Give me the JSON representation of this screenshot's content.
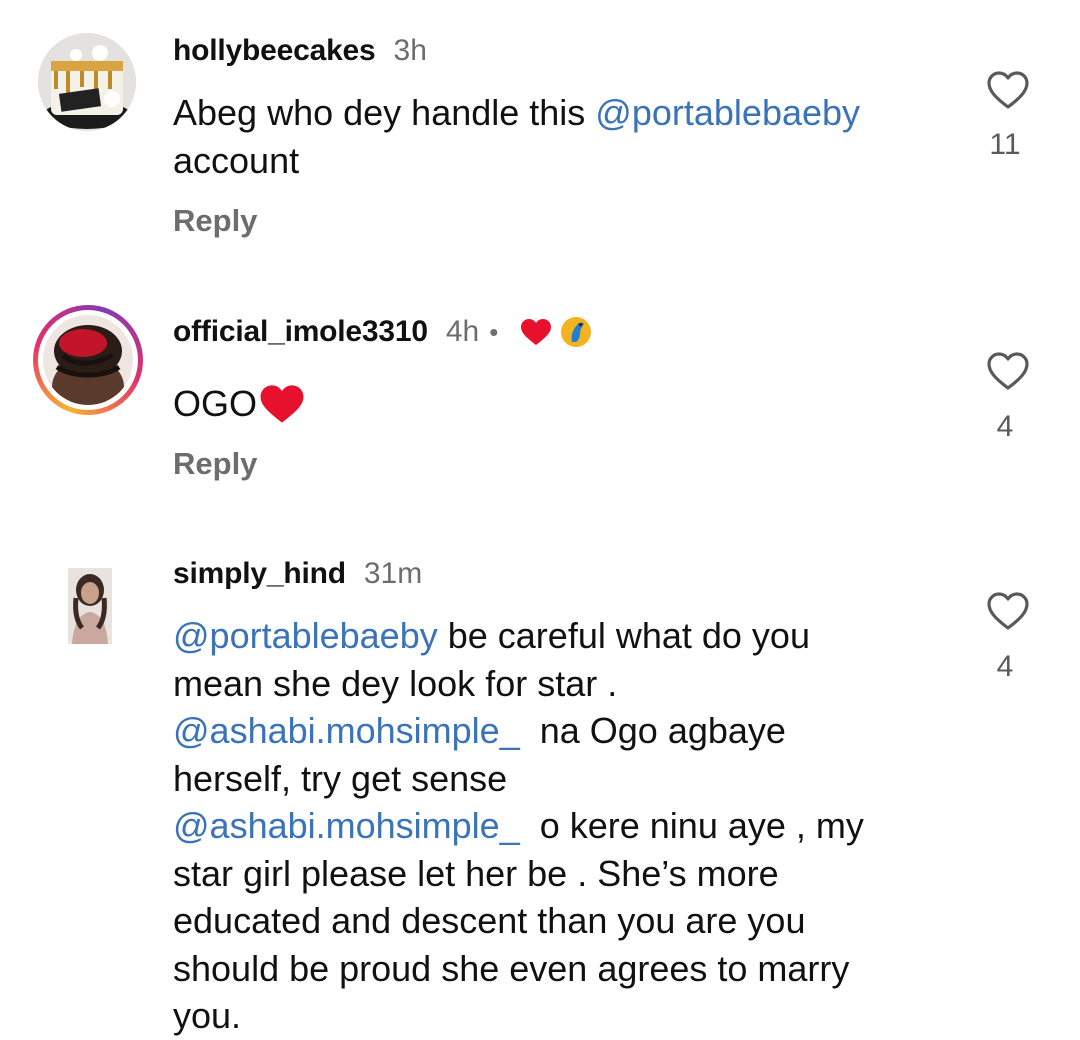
{
  "comments": [
    {
      "username": "hollybeecakes",
      "time": "3h",
      "text_mention": "@portablebaeby",
      "text_line1": "Abeg who dey handle this ",
      "text_line2": "account",
      "reply_label": "Reply",
      "likes": "11",
      "avatar_icon": "birthday-cake-photo"
    },
    {
      "username": "official_imole3310",
      "time": "4h",
      "dot": "•",
      "badges": [
        "heart-emoji",
        "parrot-emoji"
      ],
      "text": "OGO",
      "text_emoji": "red-heart-emoji",
      "reply_label": "Reply",
      "likes": "4",
      "avatar_icon": "hair-photo",
      "story_ring_colors": [
        "#f9b234",
        "#e1306c",
        "#833ab4"
      ]
    },
    {
      "username": "simply_hind",
      "time": "31m",
      "likes": "4",
      "avatar_icon": "profile-photo",
      "mention1": "@portablebaeby",
      "line1": " be careful what do you",
      "line2": "mean she dey look for star .",
      "mention2": "@ashabi.mohsimple_",
      "line3": "  na Ogo agbaye",
      "line4": "herself, try get sense",
      "mention3": "@ashabi.mohsimple_",
      "line5": "  o kere ninu aye , my",
      "line6": "star girl please let her be . She’s more",
      "line7": "educated and descent than you are you",
      "line8": "should be proud she even agrees to marry",
      "line9": "you."
    }
  ],
  "colors": {
    "mention": "#3a73b8",
    "secondary_text": "#6d6d6d",
    "heart": "#e8112d"
  }
}
